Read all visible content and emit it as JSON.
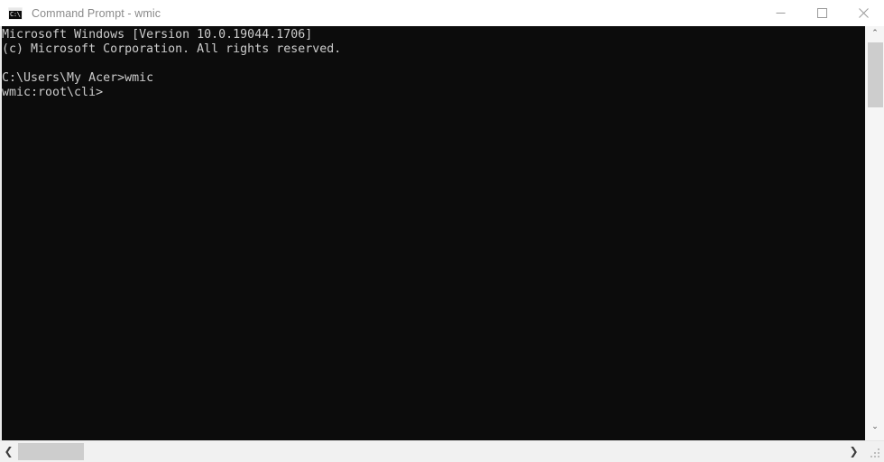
{
  "window": {
    "title": "Command Prompt - wmic",
    "icon_name": "cmd-console-icon",
    "icon_glyph": "C:\\",
    "background_color": "#0c0c0c",
    "titlebar_color": "#ffffff",
    "title_text_color": "#8a8a8a"
  },
  "window_controls": {
    "minimize_label": "Minimize",
    "maximize_label": "Maximize",
    "close_label": "Close"
  },
  "console": {
    "text_color": "#cccccc",
    "lines": [
      "Microsoft Windows [Version 10.0.19044.1706]",
      "(c) Microsoft Corporation. All rights reserved.",
      "",
      "C:\\Users\\My Acer>wmic",
      "wmic:root\\cli>"
    ],
    "full_text": "Microsoft Windows [Version 10.0.19044.1706]\n(c) Microsoft Corporation. All rights reserved.\n\nC:\\Users\\My Acer>wmic\nwmic:root\\cli>",
    "os_name": "Microsoft Windows",
    "os_version": "10.0.19044.1706",
    "copyright": "(c) Microsoft Corporation. All rights reserved.",
    "command_entered": "wmic",
    "working_directory": "C:\\Users\\My Acer",
    "current_prompt": "wmic:root\\cli>"
  },
  "scrollbars": {
    "vertical": {
      "up_arrow": "⌃",
      "down_arrow": "⌄",
      "thumb_color": "#cdcdcd"
    },
    "horizontal": {
      "left_arrow": "❮",
      "right_arrow": "❯",
      "thumb_color": "#cdcdcd"
    }
  }
}
